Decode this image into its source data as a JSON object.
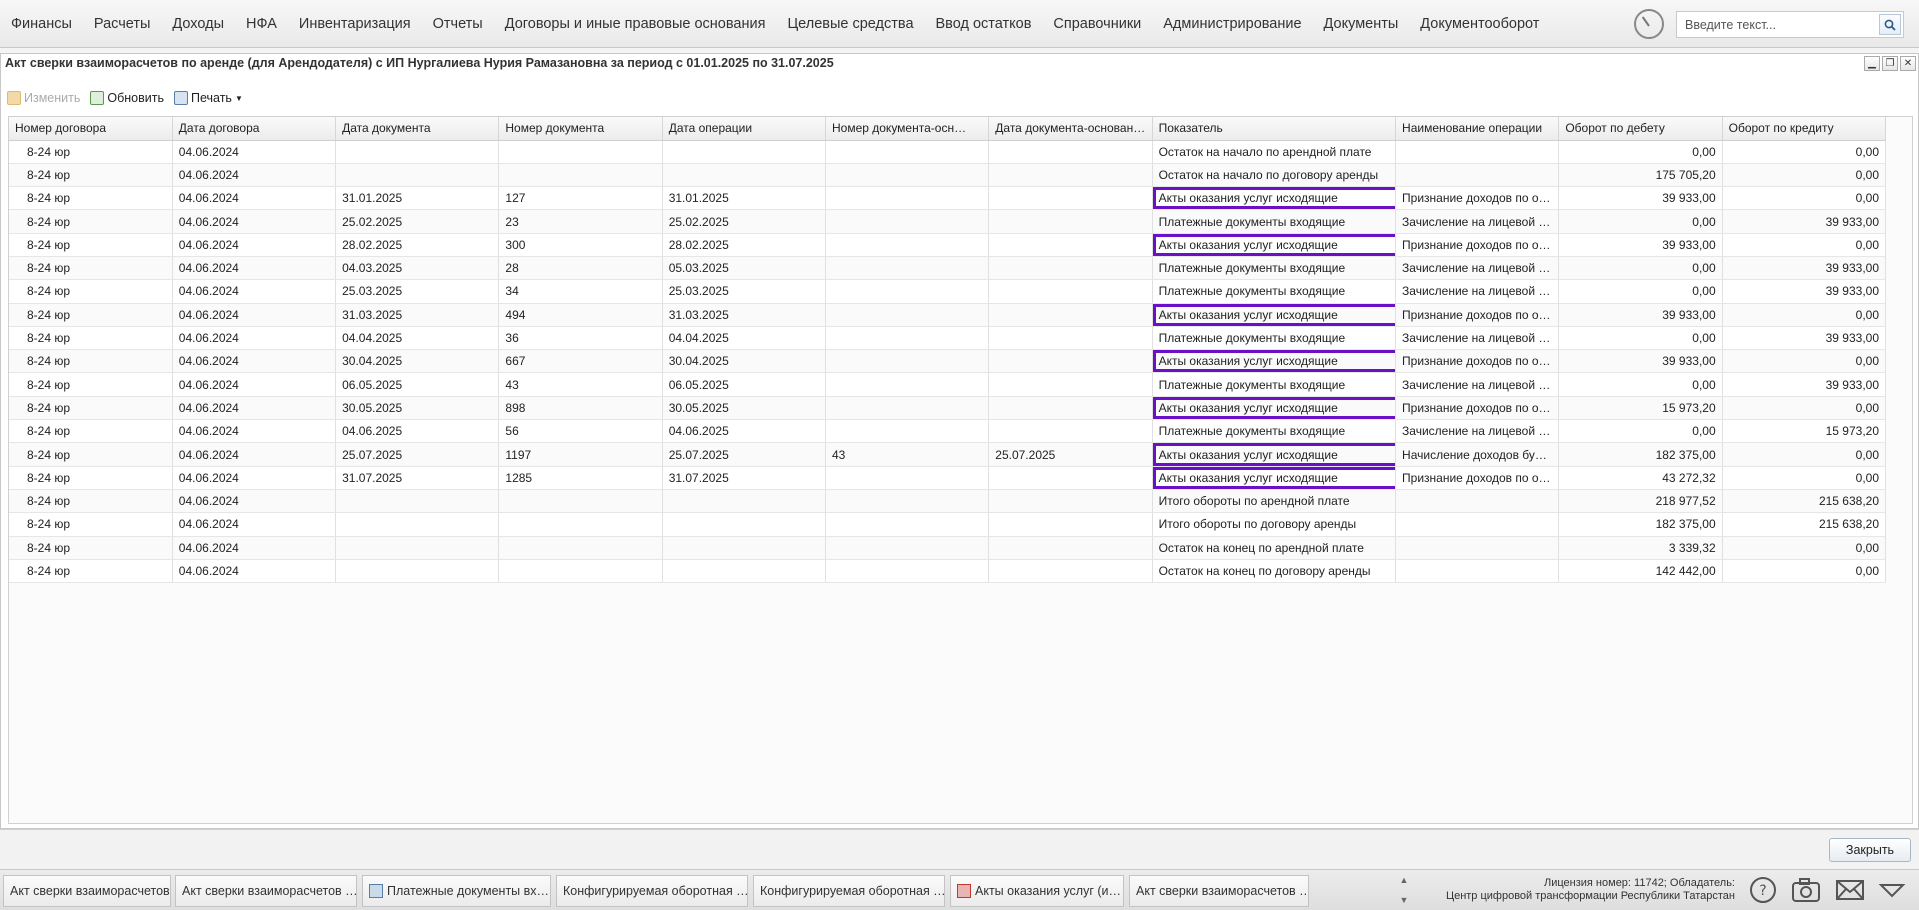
{
  "menu": [
    "Финансы",
    "Расчеты",
    "Доходы",
    "НФА",
    "Инвентаризация",
    "Отчеты",
    "Договоры и иные правовые основания",
    "Целевые средства",
    "Ввод остатков",
    "Справочники",
    "Администрирование",
    "Документы",
    "Документооборот"
  ],
  "search": {
    "placeholder": "Введите текст..."
  },
  "window": {
    "title": "Акт сверки взаиморасчетов по аренде (для Арендодателя) с ИП Нургалиева Нурия Рамазановна за период с 01.01.2025 по 31.07.2025"
  },
  "toolbar": {
    "edit": "Изменить",
    "refresh": "Обновить",
    "print": "Печать"
  },
  "grid": {
    "columns": [
      "Номер договора",
      "Дата договора",
      "Дата документа",
      "Номер документа",
      "Дата операции",
      "Номер документа-осн…",
      "Дата документа-основан…",
      "Показатель",
      "Наименование операции",
      "Оборот по дебету",
      "Оборот по кредиту"
    ],
    "rows": [
      [
        "8-24 юр",
        "04.06.2024",
        "",
        "",
        "",
        "",
        "",
        "Остаток на начало по арендной плате",
        "",
        "0,00",
        "0,00"
      ],
      [
        "8-24 юр",
        "04.06.2024",
        "",
        "",
        "",
        "",
        "",
        "Остаток на начало по договору аренды",
        "",
        "175 705,20",
        "0,00"
      ],
      [
        "8-24 юр",
        "04.06.2024",
        "31.01.2025",
        "127",
        "31.01.2025",
        "",
        "",
        "Акты оказания услуг исходящие",
        "Признание доходов по о…",
        "39 933,00",
        "0,00"
      ],
      [
        "8-24 юр",
        "04.06.2024",
        "25.02.2025",
        "23",
        "25.02.2025",
        "",
        "",
        "Платежные документы входящие",
        "Зачисление на лицевой …",
        "0,00",
        "39 933,00"
      ],
      [
        "8-24 юр",
        "04.06.2024",
        "28.02.2025",
        "300",
        "28.02.2025",
        "",
        "",
        "Акты оказания услуг исходящие",
        "Признание доходов по о…",
        "39 933,00",
        "0,00"
      ],
      [
        "8-24 юр",
        "04.06.2024",
        "04.03.2025",
        "28",
        "05.03.2025",
        "",
        "",
        "Платежные документы входящие",
        "Зачисление на лицевой …",
        "0,00",
        "39 933,00"
      ],
      [
        "8-24 юр",
        "04.06.2024",
        "25.03.2025",
        "34",
        "25.03.2025",
        "",
        "",
        "Платежные документы входящие",
        "Зачисление на лицевой …",
        "0,00",
        "39 933,00"
      ],
      [
        "8-24 юр",
        "04.06.2024",
        "31.03.2025",
        "494",
        "31.03.2025",
        "",
        "",
        "Акты оказания услуг исходящие",
        "Признание доходов по о…",
        "39 933,00",
        "0,00"
      ],
      [
        "8-24 юр",
        "04.06.2024",
        "04.04.2025",
        "36",
        "04.04.2025",
        "",
        "",
        "Платежные документы входящие",
        "Зачисление на лицевой …",
        "0,00",
        "39 933,00"
      ],
      [
        "8-24 юр",
        "04.06.2024",
        "30.04.2025",
        "667",
        "30.04.2025",
        "",
        "",
        "Акты оказания услуг исходящие",
        "Признание доходов по о…",
        "39 933,00",
        "0,00"
      ],
      [
        "8-24 юр",
        "04.06.2024",
        "06.05.2025",
        "43",
        "06.05.2025",
        "",
        "",
        "Платежные документы входящие",
        "Зачисление на лицевой …",
        "0,00",
        "39 933,00"
      ],
      [
        "8-24 юр",
        "04.06.2024",
        "30.05.2025",
        "898",
        "30.05.2025",
        "",
        "",
        "Акты оказания услуг исходящие",
        "Признание доходов по о…",
        "15 973,20",
        "0,00"
      ],
      [
        "8-24 юр",
        "04.06.2024",
        "04.06.2025",
        "56",
        "04.06.2025",
        "",
        "",
        "Платежные документы входящие",
        "Зачисление на лицевой …",
        "0,00",
        "15 973,20"
      ],
      [
        "8-24 юр",
        "04.06.2024",
        "25.07.2025",
        "1197",
        "25.07.2025",
        "43",
        "25.07.2025",
        "Акты оказания услуг исходящие",
        "Начисление доходов бу…",
        "182 375,00",
        "0,00"
      ],
      [
        "8-24 юр",
        "04.06.2024",
        "31.07.2025",
        "1285",
        "31.07.2025",
        "",
        "",
        "Акты оказания услуг исходящие",
        "Признание доходов по о…",
        "43 272,32",
        "0,00"
      ],
      [
        "8-24 юр",
        "04.06.2024",
        "",
        "",
        "",
        "",
        "",
        "Итого обороты по арендной плате",
        "",
        "218 977,52",
        "215 638,20"
      ],
      [
        "8-24 юр",
        "04.06.2024",
        "",
        "",
        "",
        "",
        "",
        "Итого обороты по договору аренды",
        "",
        "182 375,00",
        "215 638,20"
      ],
      [
        "8-24 юр",
        "04.06.2024",
        "",
        "",
        "",
        "",
        "",
        "Остаток на конец по арендной плате",
        "",
        "3 339,32",
        "0,00"
      ],
      [
        "8-24 юр",
        "04.06.2024",
        "",
        "",
        "",
        "",
        "",
        "Остаток на конец по договору аренды",
        "",
        "142 442,00",
        "0,00"
      ]
    ],
    "highlighted_rows": [
      2,
      4,
      7,
      9,
      11,
      13,
      14
    ]
  },
  "close_button": "Закрыть",
  "taskbar": [
    {
      "label": "Акт сверки взаиморасчетов",
      "icon": "none"
    },
    {
      "label": "Акт сверки взаиморасчетов …",
      "icon": "none"
    },
    {
      "label": "Платежные документы вх…",
      "icon": "document-icon"
    },
    {
      "label": "Конфигурируемая оборотная …",
      "icon": "none"
    },
    {
      "label": "Конфигурируемая оборотная …",
      "icon": "none"
    },
    {
      "label": "Акты оказания услуг (и…",
      "icon": "document-red-icon"
    },
    {
      "label": "Акт сверки взаиморасчетов …",
      "icon": "none"
    }
  ],
  "license": {
    "line1": "Лицензия номер: 11742; Обладатель:",
    "line2": "Центр цифровой трансформации Республики Татарстан"
  },
  "colors": {
    "highlight": "#6b10c9"
  }
}
